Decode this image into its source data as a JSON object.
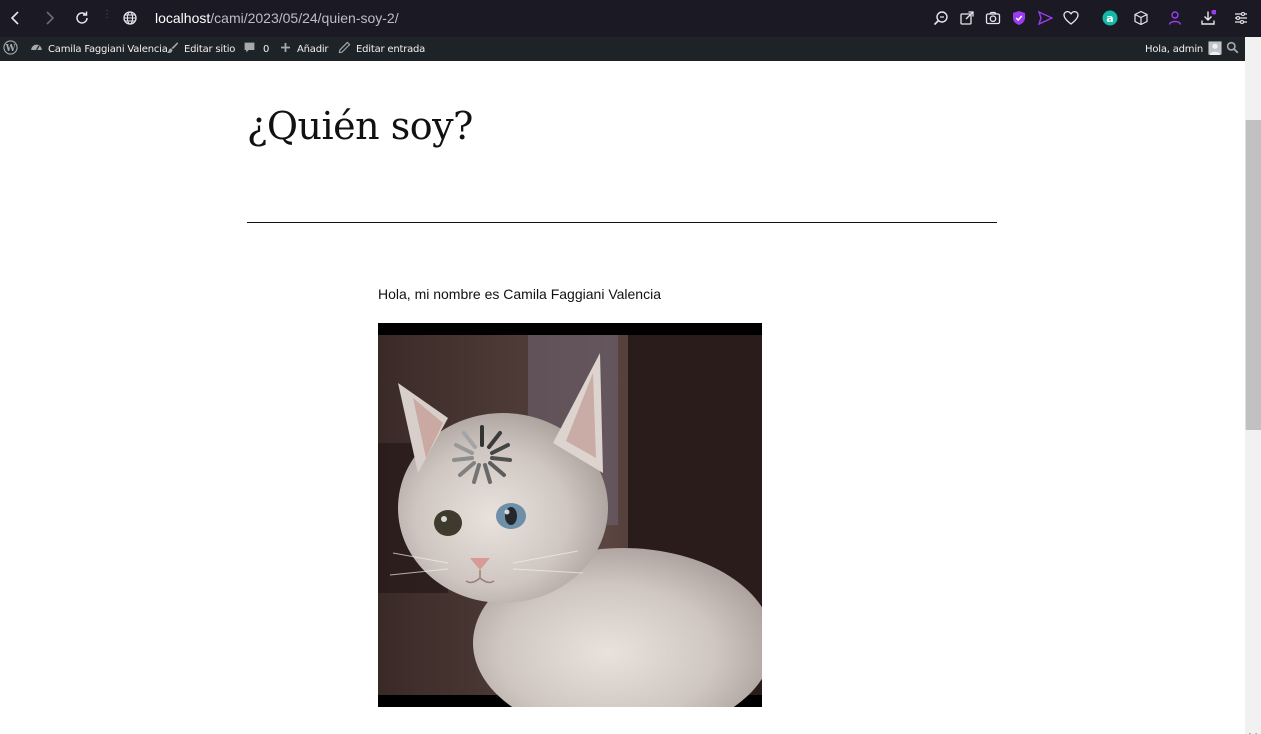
{
  "browser": {
    "url_host": "localhost",
    "url_path": "/cami/2023/05/24/quien-soy-2/"
  },
  "admin_bar": {
    "site_name": "Camila Faggiani Valencia",
    "edit_site": "Editar sitio",
    "comments_count": "0",
    "add_new": "Añadir",
    "edit_post": "Editar entrada",
    "greeting": "Hola, admin"
  },
  "post": {
    "title": "¿Quién soy?",
    "intro": "Hola, mi nombre es Camila Faggiani Valencia"
  },
  "colors": {
    "browser_bg": "#1b1a24",
    "admin_bar_bg": "#1d2327",
    "accent_purple": "#8a2be2"
  },
  "icons": [
    "back-icon",
    "forward-icon",
    "reload-icon",
    "globe-icon",
    "zoom-icon",
    "share-icon",
    "camera-icon",
    "shield-icon",
    "send-icon",
    "heart-icon",
    "extension-a-icon",
    "cube-icon",
    "profile-icon",
    "download-icon",
    "menu-icon",
    "wordpress-icon",
    "dashboard-icon",
    "brush-icon",
    "comment-icon",
    "plus-icon",
    "pencil-icon",
    "avatar-icon",
    "search-icon",
    "loading-spinner-icon"
  ]
}
